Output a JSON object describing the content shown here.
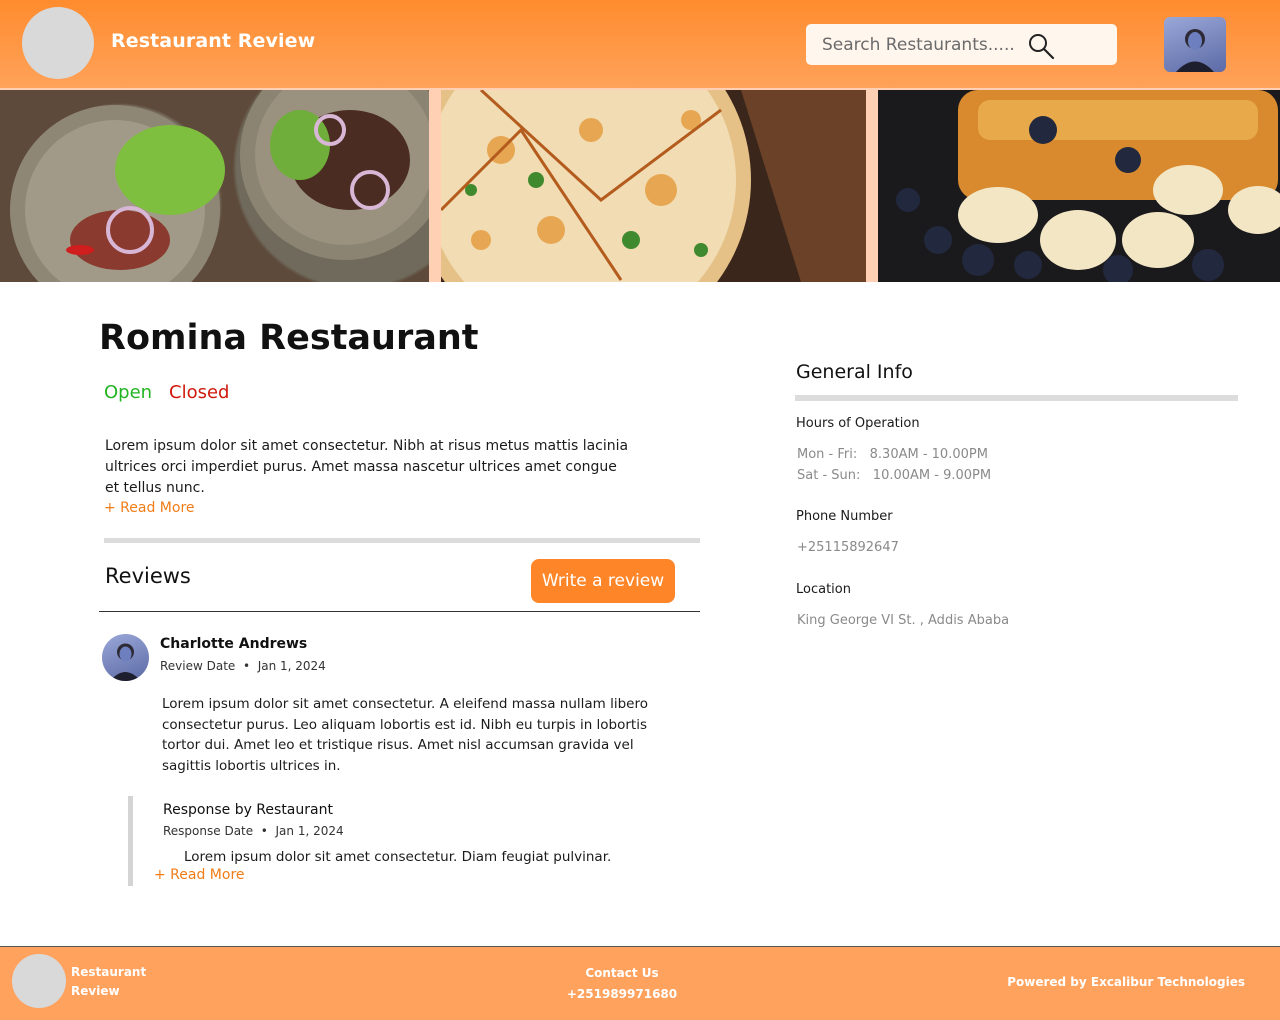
{
  "header": {
    "brand": "Restaurant Review",
    "search_placeholder": "Search Restaurants.....",
    "icons": {
      "search": "search-icon",
      "avatar": "user-avatar"
    },
    "colors": {
      "accent": "#ff8c2e",
      "open": "#22b422",
      "closed": "#d0180b",
      "link": "#f07d18"
    }
  },
  "banner": {
    "images": [
      "steak-salad-photo",
      "pizza-photo",
      "french-toast-banana-blueberry-photo"
    ]
  },
  "restaurant": {
    "name": "Romina Restaurant",
    "status_open": "Open",
    "status_closed": "Closed",
    "description": "Lorem ipsum dolor sit amet consectetur. Nibh at risus metus mattis lacinia ultrices orci imperdiet purus. Amet massa nascetur ultrices amet congue et tellus nunc.",
    "read_more": "+ Read More"
  },
  "reviews": {
    "heading": "Reviews",
    "write_button": "Write a review",
    "items": [
      {
        "author": "Charlotte Andrews",
        "date_label": "Review Date",
        "date": "Jan 1, 2024",
        "body": "Lorem ipsum dolor sit amet consectetur. A eleifend massa nullam libero consectetur purus. Leo aliquam lobortis est id. Nibh eu turpis in lobortis tortor dui. Amet leo et tristique risus. Amet nisl accumsan gravida vel sagittis lobortis ultrices in.",
        "response": {
          "title": "Response by Restaurant",
          "date_label": "Response Date",
          "date": "Jan 1, 2024",
          "body": "Lorem ipsum dolor sit amet consectetur. Diam feugiat pulvinar.",
          "read_more": "+ Read More"
        }
      }
    ]
  },
  "general_info": {
    "title": "General Info",
    "hours_label": "Hours of Operation",
    "hours": [
      {
        "days": "Mon - Fri:",
        "time": "8.30AM - 10.00PM"
      },
      {
        "days": "Sat - Sun:",
        "time": "10.00AM - 9.00PM"
      }
    ],
    "phone_label": "Phone Number",
    "phone": "+25115892647",
    "location_label": "Location",
    "location": "King George VI St. , Addis Ababa"
  },
  "footer": {
    "brand_line1": "Restaurant",
    "brand_line2": "Review",
    "contact_label": "Contact Us",
    "contact_phone": "+251989971680",
    "powered_by": "Powered by Excalibur Technologies"
  }
}
